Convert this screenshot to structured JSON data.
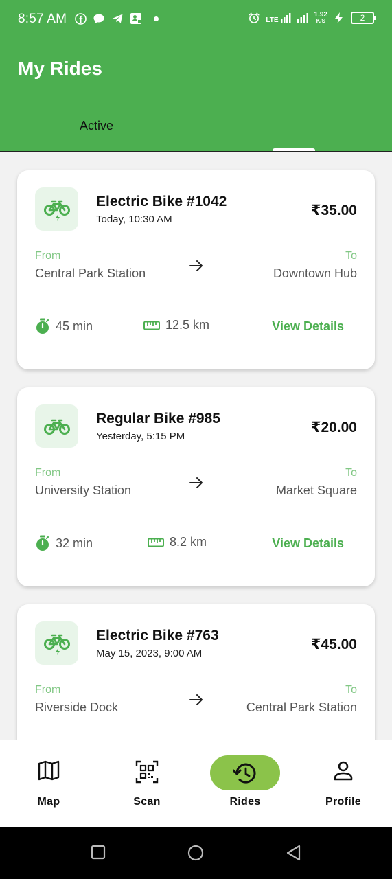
{
  "status_bar": {
    "time": "8:57 AM",
    "network_label": "LTE",
    "speed_value": "1.92",
    "speed_unit": "K/S",
    "battery_level": "2"
  },
  "app_bar": {
    "title": "My Rides"
  },
  "tabs": {
    "active_label": "Active"
  },
  "labels": {
    "from": "From",
    "to": "To",
    "view_details": "View Details"
  },
  "rides": [
    {
      "name": "Electric Bike #1042",
      "time": "Today, 10:30 AM",
      "price": "₹35.00",
      "from": "Central Park Station",
      "to": "Downtown Hub",
      "duration": "45 min",
      "distance": "12.5 km",
      "icon": "electric-bike-icon"
    },
    {
      "name": "Regular Bike #985",
      "time": "Yesterday, 5:15 PM",
      "price": "₹20.00",
      "from": "University Station",
      "to": "Market Square",
      "duration": "32 min",
      "distance": "8.2 km",
      "icon": "bike-icon"
    },
    {
      "name": "Electric Bike #763",
      "time": "May 15, 2023, 9:00 AM",
      "price": "₹45.00",
      "from": "Riverside Dock",
      "to": "Central Park Station",
      "icon": "electric-bike-icon"
    }
  ],
  "bottom_nav": [
    {
      "label": "Map",
      "icon": "map-icon"
    },
    {
      "label": "Scan",
      "icon": "qr-scan-icon"
    },
    {
      "label": "Rides",
      "icon": "history-icon",
      "selected": true
    },
    {
      "label": "Profile",
      "icon": "person-icon"
    }
  ],
  "colors": {
    "primary": "#4caf50",
    "accent_pill": "#8bc34a",
    "label_green": "#81c784",
    "badge_bg": "#e8f5e9"
  }
}
